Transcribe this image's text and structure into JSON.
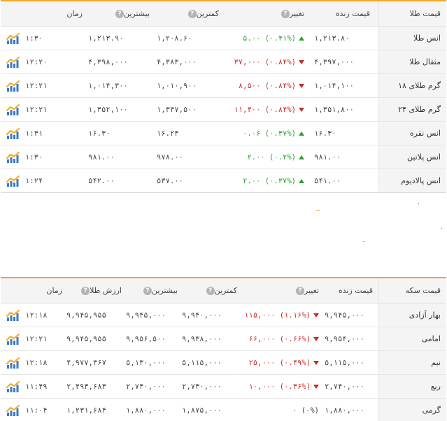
{
  "gold_table": {
    "headers": {
      "name": "قیمت طلا",
      "live": "قیمت زنده",
      "change": "تغییر",
      "low": "کمترین",
      "high": "بیشترین",
      "time": "زمان"
    },
    "rows": [
      {
        "name": "انس طلا",
        "live": "۱,۲۱۳.۸۰",
        "change": "۵.۰۰ (۰.۴۱%)",
        "dir": "up",
        "low": "۱,۲۰۸.۶۰",
        "high": "۱,۲۱۳.۹۰",
        "time": "۱:۳۰",
        "icon": "chart-icon"
      },
      {
        "name": "مثقال طلا",
        "live": "۴,۳۹۷,۰۰۰",
        "change": "۳۷,۰۰۰ (۰.۸۴%)",
        "dir": "down",
        "low": "۴,۳۸۳,۰۰۰",
        "high": "۴,۳۹۸,۰۰۰",
        "time": "۱۲:۲۰",
        "icon": "chart-icon"
      },
      {
        "name": "گرم طلای ۱۸",
        "live": "۱,۰۱۴,۱۰۰",
        "change": "۸,۵۰۰ (۰.۸۴%)",
        "dir": "down",
        "low": "۱,۰۱۰,۹۰۰",
        "high": "۱,۰۱۴,۳۰۰",
        "time": "۱۲:۲۱",
        "icon": "chart-icon"
      },
      {
        "name": "گرم طلای ۲۴",
        "live": "۱,۳۵۱,۸۰۰",
        "change": "۱۱,۴۰۰ (۰.۸۴%)",
        "dir": "down",
        "low": "۱,۳۴۷,۵۰۰",
        "high": "۱,۳۵۲,۱۰۰",
        "time": "۱۲:۲۱",
        "icon": "chart-icon"
      },
      {
        "name": "انس نقره",
        "live": "۱۶.۳۰",
        "change": "۰.۰۶ (۰.۳۷%)",
        "dir": "up",
        "low": "۱۶.۲۳",
        "high": "۱۶.۳۰",
        "time": "۱:۳۱",
        "icon": "chart-icon"
      },
      {
        "name": "انس پلاتین",
        "live": "۹۸۱.۰۰",
        "change": "۲.۰۰ (۰.۲%)",
        "dir": "up",
        "low": "۹۷۸.۰۰",
        "high": "۹۸۱.۰۰",
        "time": "۱:۳۰",
        "icon": "chart-icon"
      },
      {
        "name": "انس پالادیوم",
        "live": "۵۴۱.۰۰",
        "change": "۲.۰۰ (۰.۳۷%)",
        "dir": "up",
        "low": "۵۳۷.۰۰",
        "high": "۵۴۲.۰۰",
        "time": "۱:۲۴",
        "icon": "chart-icon"
      }
    ]
  },
  "coin_table": {
    "headers": {
      "name": "قیمت سکه",
      "live": "قیمت زنده",
      "change": "تغییر",
      "low": "کمترین",
      "high": "بیشترین",
      "value": "ارزش طلا",
      "time": "زمان"
    },
    "rows": [
      {
        "name": "بهار آزادی",
        "live": "۹,۹۴۵,۰۰۰",
        "change": "۱۱۵,۰۰۰ (۱.۱۶%)",
        "dir": "down",
        "low": "۹,۹۴۰,۰۰۰",
        "high": "۹,۹۴۵,۰۰۰",
        "value": "۹,۹۴۵,۹۵۵",
        "time": "۱۲:۱۸",
        "icon": "chart-icon"
      },
      {
        "name": "امامی",
        "live": "۹,۹۵۴,۰۰۰",
        "change": "۶۶,۰۰۰ (۰.۶۶%)",
        "dir": "down",
        "low": "۹,۹۳۸,۰۰۰",
        "high": "۹,۹۵۶,۵۰۰",
        "value": "۹,۹۴۵,۹۵۵",
        "time": "۱۲:۲۱",
        "icon": "chart-icon"
      },
      {
        "name": "نیم",
        "live": "۵,۱۱۵,۰۰۰",
        "change": "۲۵,۰۰۰ (۰.۴۹%)",
        "dir": "down",
        "low": "۵,۱۱۵,۰۰۰",
        "high": "۵,۱۳۰,۰۰۰",
        "value": "۴,۹۷۷,۳۶۷",
        "time": "۱۲:۱۸",
        "icon": "chart-icon"
      },
      {
        "name": "ربع",
        "live": "۲,۷۴۰,۰۰۰",
        "change": "۱۰,۰۰۰ (۰.۳۶%)",
        "dir": "down",
        "low": "۲,۷۳۰,۰۰۰",
        "high": "۲,۷۴۰,۰۰۰",
        "value": "۲,۴۹۳,۶۸۳",
        "time": "۱۱:۴۹",
        "icon": "chart-icon"
      },
      {
        "name": "گرمی",
        "live": "۱,۸۸۰,۰۰۰",
        "change": "۰ (۰%)",
        "dir": "flat",
        "low": "۱,۸۷۵,۰۰۰",
        "high": "۱,۸۸۰,۰۰۰",
        "value": "۱,۲۳۱,۶۸۴",
        "time": "۱۱:۰۴",
        "icon": "chart-icon"
      }
    ]
  },
  "colors": {
    "accent": "#f5a623",
    "up": "#2aa12a",
    "down": "#cc2a2a",
    "header_bg": "#f4f4f4"
  }
}
